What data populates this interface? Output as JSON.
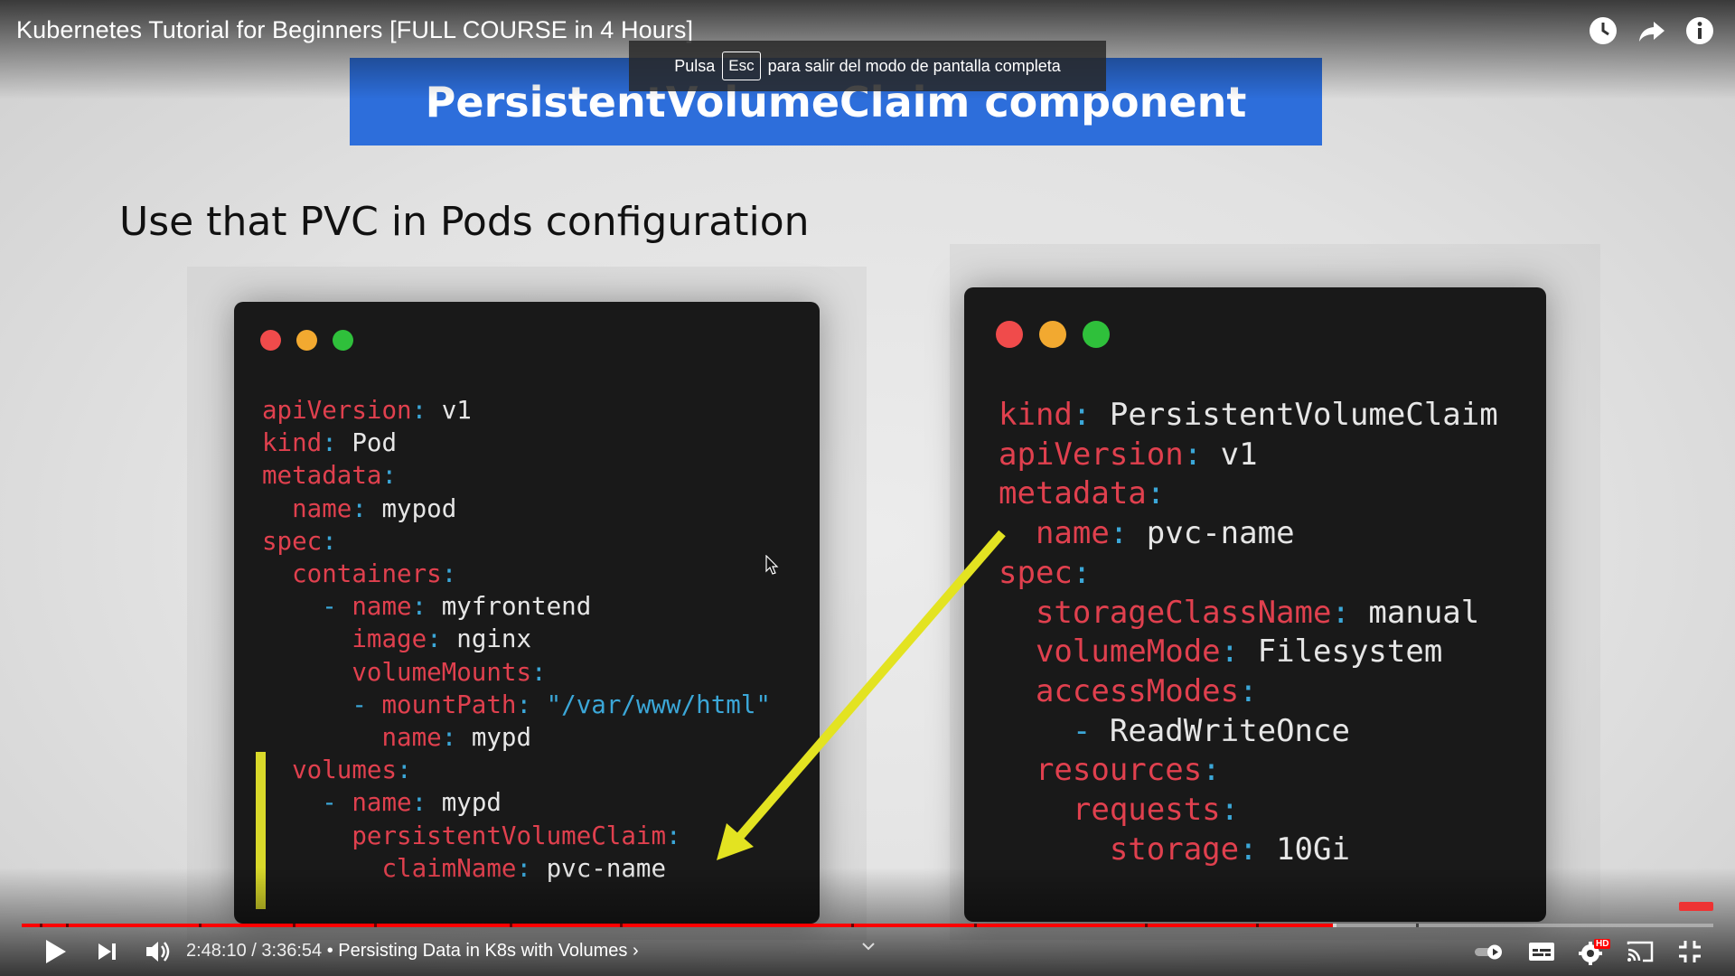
{
  "player": {
    "video_title": "Kubernetes Tutorial for Beginners [FULL COURSE in 4 Hours]",
    "fullscreen_notice": {
      "before": "Pulsa",
      "key": "Esc",
      "after": "para salir del modo de pantalla completa"
    },
    "current_time": "2:48:10",
    "duration": "3:36:54",
    "time_display": "2:48:10 / 3:36:54",
    "chapter": "• Persisting Data in K8s with Volumes",
    "chapter_chevron": "›",
    "progress_fraction": 0.775,
    "buffer_fraction": 0.777,
    "icons": {
      "watch_later": "clock-icon",
      "share": "share-arrow-icon",
      "info": "info-icon",
      "play": "play-icon",
      "next": "next-icon",
      "volume": "volume-icon",
      "autoplay": "autoplay-toggle-icon",
      "subtitles": "subtitles-icon",
      "settings": "settings-gear-icon",
      "cast": "cast-icon",
      "exit_fullscreen": "exit-fullscreen-icon"
    },
    "settings_badge": "HD",
    "accent_color": "#ff0000"
  },
  "slide": {
    "banner_title": "PersistentVolumeClaim component",
    "heading": "Use that PVC in Pods configuration",
    "banner_color": "#2d6edb",
    "left_code": [
      [
        {
          "t": "apiVersion",
          "c": "k"
        },
        {
          "t": ": ",
          "c": "p"
        },
        {
          "t": "v1",
          "c": "v"
        }
      ],
      [
        {
          "t": "kind",
          "c": "k"
        },
        {
          "t": ": ",
          "c": "p"
        },
        {
          "t": "Pod",
          "c": "v"
        }
      ],
      [
        {
          "t": "metadata",
          "c": "k"
        },
        {
          "t": ":",
          "c": "p"
        }
      ],
      [
        {
          "t": "  "
        },
        {
          "t": "name",
          "c": "k"
        },
        {
          "t": ": ",
          "c": "p"
        },
        {
          "t": "mypod",
          "c": "v"
        }
      ],
      [
        {
          "t": "spec",
          "c": "k"
        },
        {
          "t": ":",
          "c": "p"
        }
      ],
      [
        {
          "t": "  "
        },
        {
          "t": "containers",
          "c": "k"
        },
        {
          "t": ":",
          "c": "p"
        }
      ],
      [
        {
          "t": "    "
        },
        {
          "t": "- ",
          "c": "p"
        },
        {
          "t": "name",
          "c": "k"
        },
        {
          "t": ": ",
          "c": "p"
        },
        {
          "t": "myfrontend",
          "c": "v"
        }
      ],
      [
        {
          "t": "      "
        },
        {
          "t": "image",
          "c": "k"
        },
        {
          "t": ": ",
          "c": "p"
        },
        {
          "t": "nginx",
          "c": "v"
        }
      ],
      [
        {
          "t": "      "
        },
        {
          "t": "volumeMounts",
          "c": "k"
        },
        {
          "t": ":",
          "c": "p"
        }
      ],
      [
        {
          "t": "      "
        },
        {
          "t": "- ",
          "c": "p"
        },
        {
          "t": "mountPath",
          "c": "k"
        },
        {
          "t": ": ",
          "c": "p"
        },
        {
          "t": "\"/var/www/html\"",
          "c": "s"
        }
      ],
      [
        {
          "t": "        "
        },
        {
          "t": "name",
          "c": "k"
        },
        {
          "t": ": ",
          "c": "p"
        },
        {
          "t": "mypd",
          "c": "v"
        }
      ],
      [
        {
          "t": "  "
        },
        {
          "t": "volumes",
          "c": "k"
        },
        {
          "t": ":",
          "c": "p"
        }
      ],
      [
        {
          "t": "    "
        },
        {
          "t": "- ",
          "c": "p"
        },
        {
          "t": "name",
          "c": "k"
        },
        {
          "t": ": ",
          "c": "p"
        },
        {
          "t": "mypd",
          "c": "v"
        }
      ],
      [
        {
          "t": "      "
        },
        {
          "t": "persistentVolumeClaim",
          "c": "k"
        },
        {
          "t": ":",
          "c": "p"
        }
      ],
      [
        {
          "t": "        "
        },
        {
          "t": "claimName",
          "c": "k"
        },
        {
          "t": ": ",
          "c": "p"
        },
        {
          "t": "pvc-name",
          "c": "v"
        }
      ]
    ],
    "right_code": [
      [
        {
          "t": "kind",
          "c": "k"
        },
        {
          "t": ": ",
          "c": "p"
        },
        {
          "t": "PersistentVolumeClaim",
          "c": "v"
        }
      ],
      [
        {
          "t": "apiVersion",
          "c": "k"
        },
        {
          "t": ": ",
          "c": "p"
        },
        {
          "t": "v1",
          "c": "v"
        }
      ],
      [
        {
          "t": "metadata",
          "c": "k"
        },
        {
          "t": ":",
          "c": "p"
        }
      ],
      [
        {
          "t": "  "
        },
        {
          "t": "name",
          "c": "k"
        },
        {
          "t": ": ",
          "c": "p"
        },
        {
          "t": "pvc-name",
          "c": "v"
        }
      ],
      [
        {
          "t": "spec",
          "c": "k"
        },
        {
          "t": ":",
          "c": "p"
        }
      ],
      [
        {
          "t": "  "
        },
        {
          "t": "storageClassName",
          "c": "k"
        },
        {
          "t": ": ",
          "c": "p"
        },
        {
          "t": "manual",
          "c": "v"
        }
      ],
      [
        {
          "t": "  "
        },
        {
          "t": "volumeMode",
          "c": "k"
        },
        {
          "t": ": ",
          "c": "p"
        },
        {
          "t": "Filesystem",
          "c": "v"
        }
      ],
      [
        {
          "t": "  "
        },
        {
          "t": "accessModes",
          "c": "k"
        },
        {
          "t": ":",
          "c": "p"
        }
      ],
      [
        {
          "t": "    "
        },
        {
          "t": "- ",
          "c": "p"
        },
        {
          "t": "ReadWriteOnce",
          "c": "v"
        }
      ],
      [
        {
          "t": "  "
        },
        {
          "t": "resources",
          "c": "k"
        },
        {
          "t": ":",
          "c": "p"
        }
      ],
      [
        {
          "t": "    "
        },
        {
          "t": "requests",
          "c": "k"
        },
        {
          "t": ":",
          "c": "p"
        }
      ],
      [
        {
          "t": "      "
        },
        {
          "t": "storage",
          "c": "k"
        },
        {
          "t": ": ",
          "c": "p"
        },
        {
          "t": "10Gi",
          "c": "v"
        }
      ]
    ],
    "colors": {
      "key": "#e0404e",
      "punct": "#3ba7d8",
      "value": "#e6e6e6",
      "highlight": "#d9d92a"
    }
  }
}
